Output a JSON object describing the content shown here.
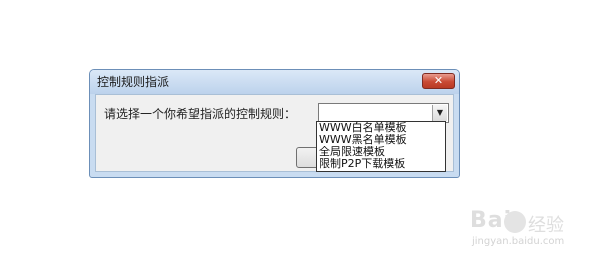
{
  "dialog": {
    "title": "控制规则指派",
    "close_icon": "close-x-icon",
    "prompt_label": "请选择一个你希望指派的控制规则：",
    "rule_select": {
      "value": "",
      "options": [
        "WWW白名单模板",
        "WWW黑名单模板",
        "全局限速模板",
        "限制P2P下载模板"
      ]
    }
  },
  "watermark": {
    "brand": "Bai",
    "paw_icon": "paw-icon",
    "text": "经验",
    "url": "jingyan.baidu.com"
  }
}
